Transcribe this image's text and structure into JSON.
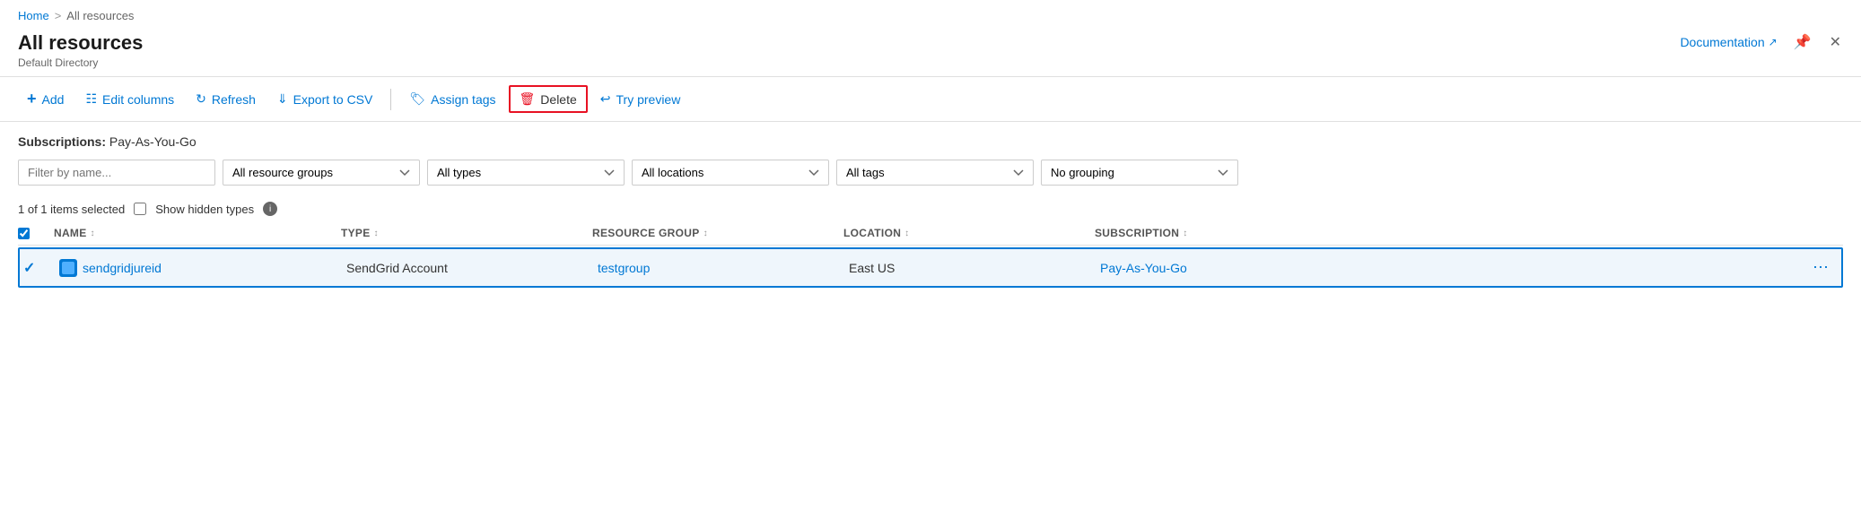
{
  "breadcrumb": {
    "home": "Home",
    "separator": ">",
    "current": "All resources"
  },
  "page": {
    "title": "All resources",
    "subtitle": "Default Directory"
  },
  "header_actions": {
    "documentation": "Documentation",
    "pin_label": "Pin",
    "close_label": "Close"
  },
  "toolbar": {
    "add": "Add",
    "edit_columns": "Edit columns",
    "refresh": "Refresh",
    "export_csv": "Export to CSV",
    "assign_tags": "Assign tags",
    "delete": "Delete",
    "try_preview": "Try preview"
  },
  "subscriptions": {
    "label": "Subscriptions:",
    "value": "Pay-As-You-Go"
  },
  "filters": {
    "name_placeholder": "Filter by name...",
    "resource_groups": "All resource groups",
    "types": "All types",
    "locations": "All locations",
    "tags": "All tags",
    "grouping": "No grouping"
  },
  "selection": {
    "count": "1 of 1 items selected",
    "show_hidden": "Show hidden types"
  },
  "table": {
    "columns": {
      "name": "NAME",
      "type": "TYPE",
      "resource_group": "RESOURCE GROUP",
      "location": "LOCATION",
      "subscription": "SUBSCRIPTION"
    },
    "rows": [
      {
        "checked": true,
        "name": "sendgridjureid",
        "type": "SendGrid Account",
        "resource_group": "testgroup",
        "location": "East US",
        "subscription": "Pay-As-You-Go"
      }
    ]
  }
}
